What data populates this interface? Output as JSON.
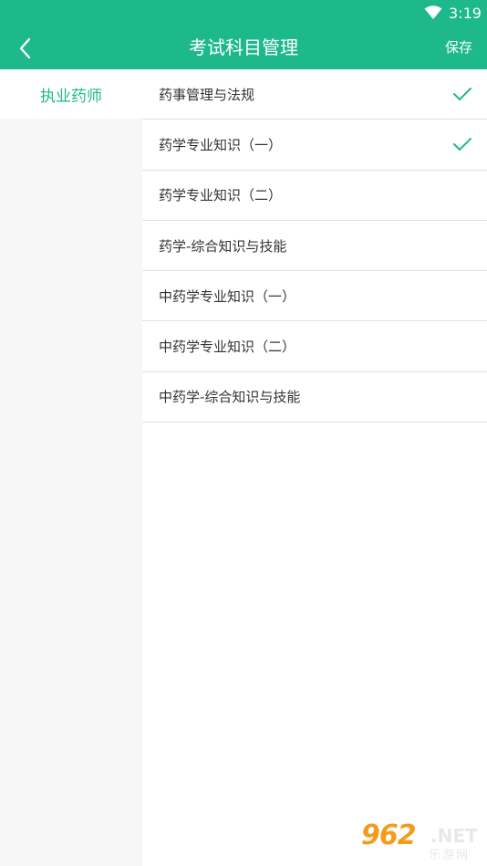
{
  "status_bar": {
    "time": "3:19"
  },
  "header": {
    "title": "考试科目管理",
    "save_label": "保存"
  },
  "sidebar": {
    "items": [
      {
        "label": "执业药师",
        "selected": true
      }
    ]
  },
  "subjects": [
    {
      "label": "药事管理与法规",
      "checked": true
    },
    {
      "label": "药学专业知识（一）",
      "checked": true
    },
    {
      "label": "药学专业知识（二）",
      "checked": false
    },
    {
      "label": "药学-综合知识与技能",
      "checked": false
    },
    {
      "label": "中药学专业知识（一）",
      "checked": false
    },
    {
      "label": "中药学专业知识（二）",
      "checked": false
    },
    {
      "label": "中药学-综合知识与技能",
      "checked": false
    }
  ],
  "watermark": {
    "number": "962",
    "domain": ".NET",
    "subtitle": "乐游网"
  },
  "colors": {
    "accent": "#1eb88d",
    "background": "#f7f7f7",
    "divider": "#e2e2e2",
    "text": "#333333"
  }
}
